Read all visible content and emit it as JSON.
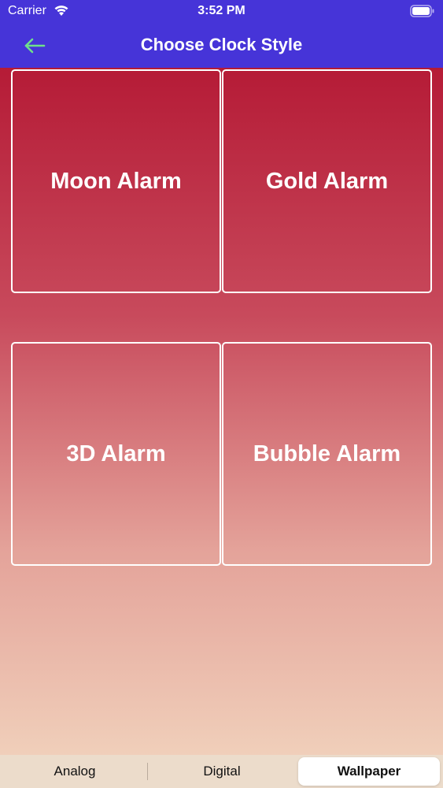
{
  "status_bar": {
    "carrier": "Carrier",
    "time": "3:52 PM",
    "wifi_icon": "wifi-icon",
    "battery_icon": "battery-icon"
  },
  "header": {
    "title": "Choose Clock Style",
    "back_icon": "back-arrow-icon",
    "bg_color": "#4634d8",
    "back_color": "#6ee08a"
  },
  "tiles": [
    {
      "label": "Moon Alarm"
    },
    {
      "label": "Gold Alarm"
    },
    {
      "label": "3D Alarm"
    },
    {
      "label": "Bubble Alarm"
    }
  ],
  "tabs": [
    {
      "label": "Analog",
      "selected": false
    },
    {
      "label": "Digital",
      "selected": false
    },
    {
      "label": "Wallpaper",
      "selected": true
    }
  ]
}
